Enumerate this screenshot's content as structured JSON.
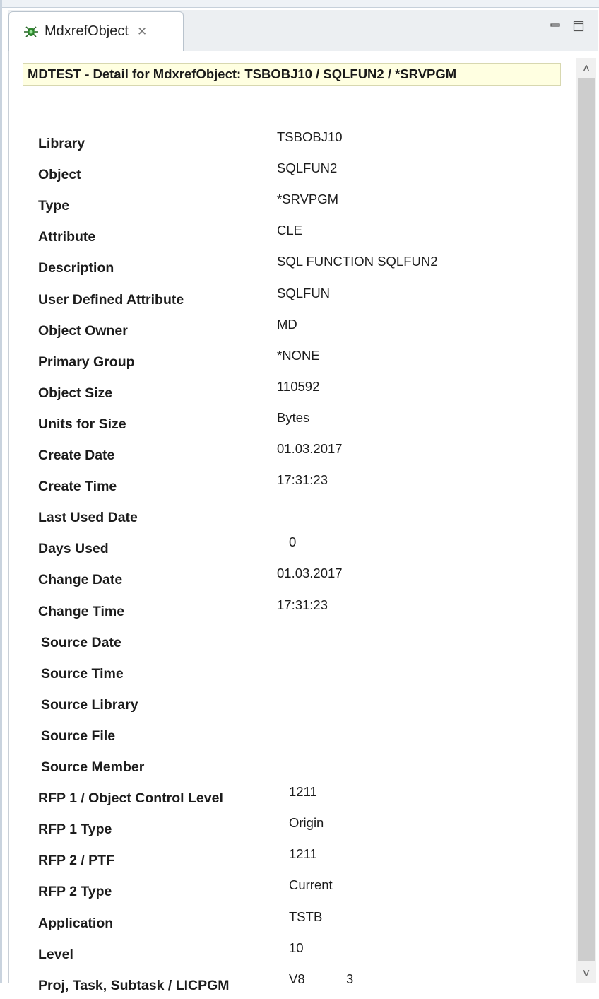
{
  "tab": {
    "title": "MdxrefObject",
    "close_glyph": "✕",
    "icon": "bug-icon"
  },
  "view_controls": {
    "minimize_glyph": "—",
    "maximize_glyph": "□"
  },
  "banner": "MDTEST -  Detail for MdxrefObject: TSBOBJ10 / SQLFUN2 / *SRVPGM",
  "fields": [
    {
      "label": "Library",
      "value": "TSBOBJ10"
    },
    {
      "label": "Object",
      "value": "SQLFUN2"
    },
    {
      "label": "Type",
      "value": "*SRVPGM"
    },
    {
      "label": "Attribute",
      "value": "CLE"
    },
    {
      "label": "Description",
      "value": "SQL FUNCTION SQLFUN2"
    },
    {
      "label": "User Defined Attribute",
      "value": "SQLFUN"
    },
    {
      "label": "Object Owner",
      "value": "MD"
    },
    {
      "label": "Primary Group",
      "value": "*NONE"
    },
    {
      "label": "Object Size",
      "value": "110592"
    },
    {
      "label": "Units for Size",
      "value": "Bytes"
    },
    {
      "label": "Create Date",
      "value": "01.03.2017"
    },
    {
      "label": "Create Time",
      "value": "17:31:23"
    },
    {
      "label": "Last Used Date",
      "value": ""
    },
    {
      "label": "Days Used",
      "value": "0"
    },
    {
      "label": "Change Date",
      "value": "01.03.2017"
    },
    {
      "label": "Change Time",
      "value": "17:31:23"
    },
    {
      "label": "Source Date",
      "value": ""
    },
    {
      "label": "Source Time",
      "value": ""
    },
    {
      "label": "Source Library",
      "value": ""
    },
    {
      "label": "Source File",
      "value": ""
    },
    {
      "label": "Source Member",
      "value": ""
    },
    {
      "label": "RFP 1 / Object Control Level",
      "value": "1211"
    },
    {
      "label": "RFP 1 Type",
      "value": "Origin"
    },
    {
      "label": "RFP 2 / PTF",
      "value": "1211"
    },
    {
      "label": "RFP 2 Type",
      "value": "Current"
    },
    {
      "label": "Application",
      "value": "TSTB"
    },
    {
      "label": "Level",
      "value": "10"
    },
    {
      "label": "Proj, Task, Subtask / LICPGM",
      "value": "V8",
      "extra": "3"
    }
  ],
  "scrollbar": {
    "up_glyph": "˄",
    "down_glyph": "˅"
  }
}
